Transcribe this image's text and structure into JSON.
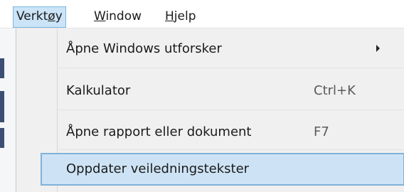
{
  "menubar": {
    "items": [
      {
        "label_pre": "Verkt",
        "label_ul": "ø",
        "label_post": "y"
      },
      {
        "label_pre": "",
        "label_ul": "W",
        "label_post": "indow"
      },
      {
        "label_pre": "",
        "label_ul": "H",
        "label_post": "jelp"
      }
    ],
    "active_index": 0
  },
  "dropdown": {
    "items": [
      {
        "label": "Åpne Windows utforsker",
        "shortcut": "",
        "has_submenu": true,
        "icon": "chevron-right-icon"
      },
      {
        "label": "Kalkulator",
        "shortcut": "Ctrl+K",
        "has_submenu": false
      },
      {
        "label": "Åpne rapport eller dokument",
        "shortcut": "F7",
        "has_submenu": false
      },
      {
        "label": "Oppdater veiledningstekster",
        "shortcut": "",
        "has_submenu": false,
        "highlighted": true
      }
    ]
  },
  "colors": {
    "highlight_fill": "#cde3f5",
    "highlight_border": "#7fb2d9",
    "menu_background": "#f0f0f0"
  }
}
